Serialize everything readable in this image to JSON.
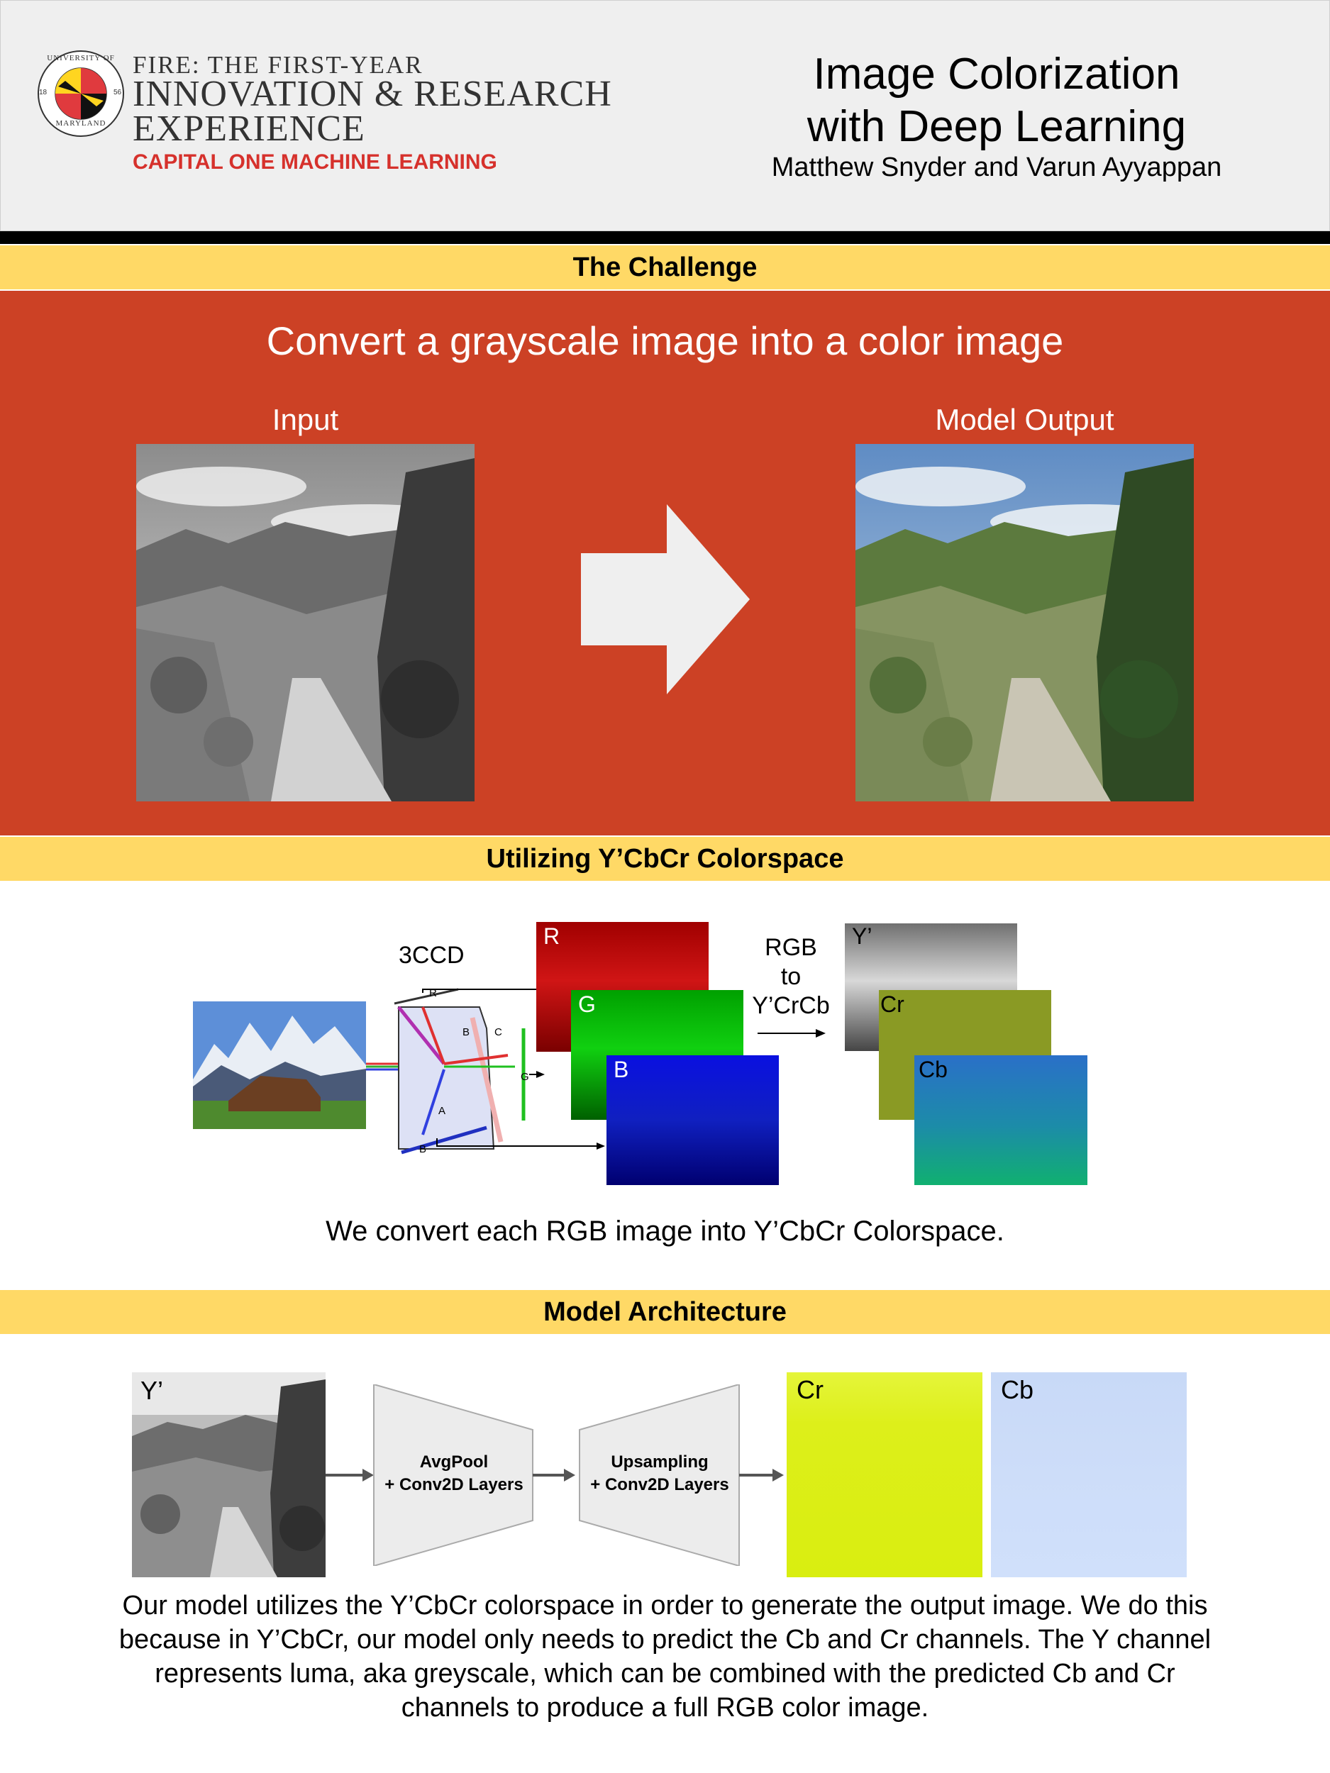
{
  "header": {
    "logo_program_line1": "FIRE: THE FIRST-YEAR",
    "logo_program_line2": "INNOVATION & RESEARCH",
    "logo_program_line3": "EXPERIENCE",
    "logo_track": "CAPITAL ONE MACHINE LEARNING",
    "seal_text_top": "UNIVERSITY OF",
    "seal_text_bottom": "MARYLAND",
    "seal_year_left": "18",
    "seal_year_right": "56",
    "title_line1": "Image Colorization",
    "title_line2": "with Deep Learning",
    "authors": "Matthew Snyder and Varun Ayyappan"
  },
  "challenge": {
    "section_title": "The Challenge",
    "headline": "Convert a grayscale image into a color image",
    "input_label": "Input",
    "output_label": "Model Output"
  },
  "colorspace": {
    "section_title": "Utilizing Y’CbCr Colorspace",
    "sensor_label": "3CCD",
    "prism_labels": {
      "r": "R",
      "b_top": "B",
      "c": "C",
      "g": "G",
      "a": "A",
      "b_bottom": "B"
    },
    "rgb_channels": [
      "R",
      "G",
      "B"
    ],
    "conversion_line1": "RGB",
    "conversion_line2": "to",
    "conversion_line3": "Y’CrCb",
    "ycbcr_channels": [
      "Y’",
      "Cr",
      "Cb"
    ],
    "caption": "We convert each RGB image into Y’CbCr Colorspace."
  },
  "architecture": {
    "section_title": "Model Architecture",
    "input_label": "Y’",
    "encoder_line1": "AvgPool",
    "encoder_line2": "+ Conv2D Layers",
    "decoder_line1": "Upsampling",
    "decoder_line2": "+ Conv2D Layers",
    "output_cr": "Cr",
    "output_cb": "Cb",
    "description": "Our model utilizes the Y’CbCr colorspace in order to generate the output image. We do this because in Y’CbCr, our model only needs to predict the Cb and Cr channels. The Y channel represents luma, aka greyscale, which can be combined with the predicted Cb and Cr channels to produce a full RGB color image."
  },
  "colors": {
    "section_bar": "#ffd966",
    "challenge_bg": "#cc4125",
    "brand_red": "#d6312c",
    "header_bg": "#efefef"
  }
}
